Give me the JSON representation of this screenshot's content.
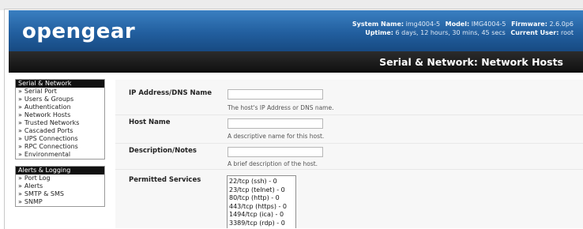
{
  "header": {
    "logo": "opengear",
    "system_name_label": "System Name:",
    "system_name": "img4004-5",
    "model_label": "Model:",
    "model": "IMG4004-5",
    "firmware_label": "Firmware:",
    "firmware": "2.6.0p6",
    "uptime_label": "Uptime:",
    "uptime": "6 days, 12 hours, 30 mins, 45 secs",
    "current_user_label": "Current User:",
    "current_user": "root"
  },
  "page_title": "Serial & Network: Network Hosts",
  "sidebar": {
    "sections": [
      {
        "title": "Serial & Network",
        "items": [
          "Serial Port",
          "Users & Groups",
          "Authentication",
          "Network Hosts",
          "Trusted Networks",
          "Cascaded Ports",
          "UPS Connections",
          "RPC Connections",
          "Environmental"
        ]
      },
      {
        "title": "Alerts & Logging",
        "items": [
          "Port Log",
          "Alerts",
          "SMTP & SMS",
          "SNMP"
        ]
      }
    ],
    "arrow": "»"
  },
  "form": {
    "ip": {
      "label": "IP Address/DNS Name",
      "value": "",
      "help": "The host's IP Address or DNS name."
    },
    "hostname": {
      "label": "Host Name",
      "value": "",
      "help": "A descriptive name for this host."
    },
    "description": {
      "label": "Description/Notes",
      "value": "",
      "help": "A brief description of the host."
    },
    "services": {
      "label": "Permitted Services",
      "options": [
        "22/tcp (ssh) - 0",
        "23/tcp (telnet) - 0",
        "80/tcp (http) - 0",
        "443/tcp (https) - 0",
        "1494/tcp (ica) - 0",
        "3389/tcp (rdp) - 0"
      ]
    }
  },
  "colors": {
    "header_blue": "#225f9f",
    "title_bar": "#111111"
  }
}
